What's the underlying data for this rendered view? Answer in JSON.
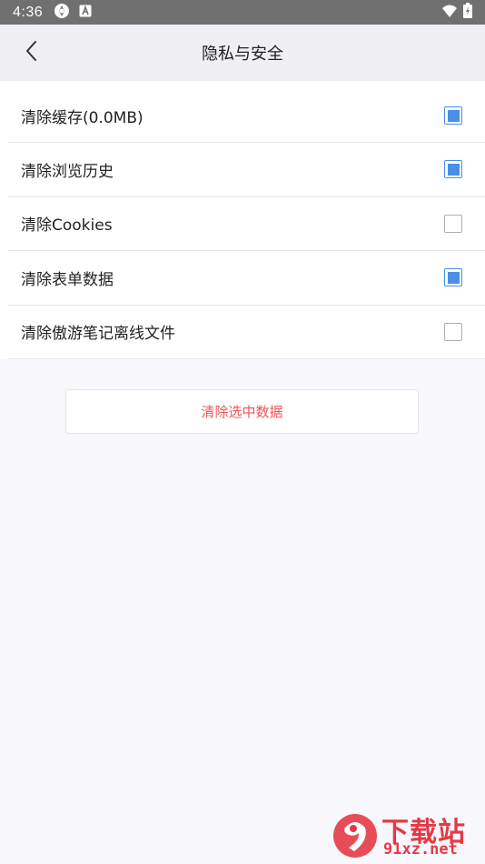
{
  "status_bar": {
    "time": "4:36",
    "icons": [
      "sync-icon",
      "a-icon",
      "wifi-icon",
      "battery-icon"
    ]
  },
  "header": {
    "title": "隐私与安全",
    "back_icon": "chevron-left-icon"
  },
  "settings": [
    {
      "label": "清除缓存(0.0MB)",
      "checked": true
    },
    {
      "label": "清除浏览历史",
      "checked": true
    },
    {
      "label": "清除Cookies",
      "checked": false
    },
    {
      "label": "清除表单数据",
      "checked": true
    },
    {
      "label": "清除傲游笔记离线文件",
      "checked": false
    }
  ],
  "action": {
    "clear_selected_label": "清除选中数据"
  },
  "watermark": {
    "title": "下载站",
    "url": "91xz.net"
  },
  "colors": {
    "accent_blue": "#4a8fe7",
    "danger_red": "#f0555a",
    "status_bar_bg": "#707070",
    "header_bg": "#efeff4",
    "watermark_red": "#e53845"
  }
}
